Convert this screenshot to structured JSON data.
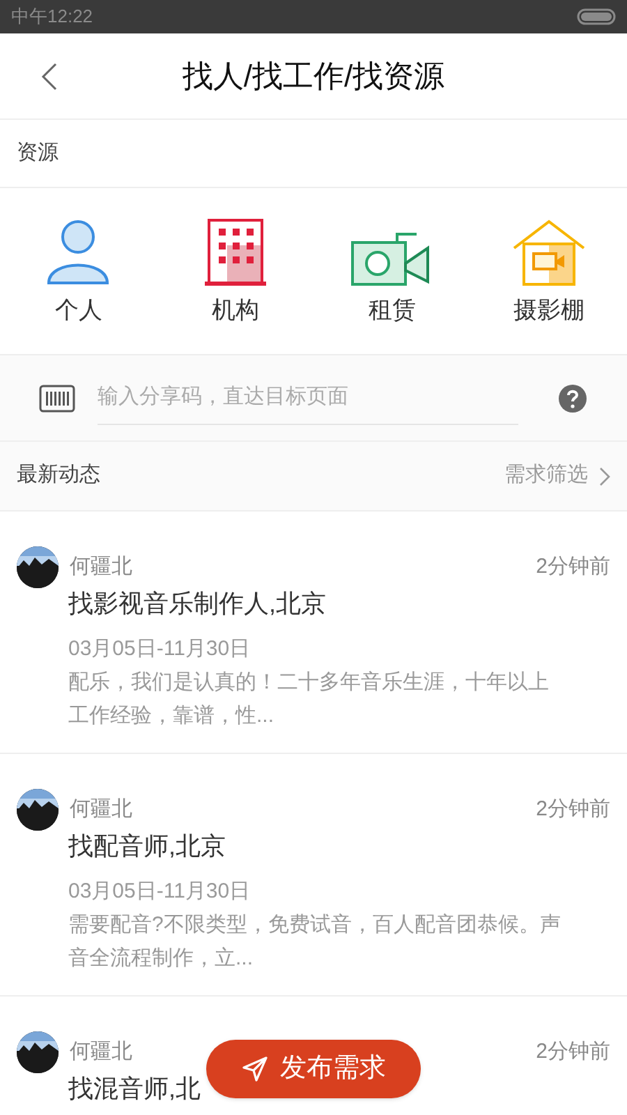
{
  "status_bar": {
    "time": "中午12:22"
  },
  "header": {
    "title": "找人/找工作/找资源"
  },
  "section": {
    "title": "资源"
  },
  "categories": [
    {
      "kind": "person",
      "label": "个人"
    },
    {
      "kind": "building",
      "label": "机构"
    },
    {
      "kind": "camera",
      "label": "租赁"
    },
    {
      "kind": "studio",
      "label": "摄影棚"
    }
  ],
  "share_code": {
    "placeholder": "输入分享码，直达目标页面"
  },
  "feed_header": {
    "title": "最新动态",
    "filter": "需求筛选"
  },
  "posts": [
    {
      "author": "何疆北",
      "time": "2分钟前",
      "title": "找影视音乐制作人,北京",
      "dates": "03月05日-11月30日",
      "body": "配乐，我们是认真的！二十多年音乐生涯，十年以上工作经验，靠谱，性..."
    },
    {
      "author": "何疆北",
      "time": "2分钟前",
      "title": "找配音师,北京",
      "dates": "03月05日-11月30日",
      "body": "需要配音?不限类型，免费试音，百人配音团恭候。声音全流程制作，立..."
    },
    {
      "author": "何疆北",
      "time": "2分钟前",
      "title": "找混音师,北"
    }
  ],
  "publish_button": {
    "label": "发布需求"
  }
}
